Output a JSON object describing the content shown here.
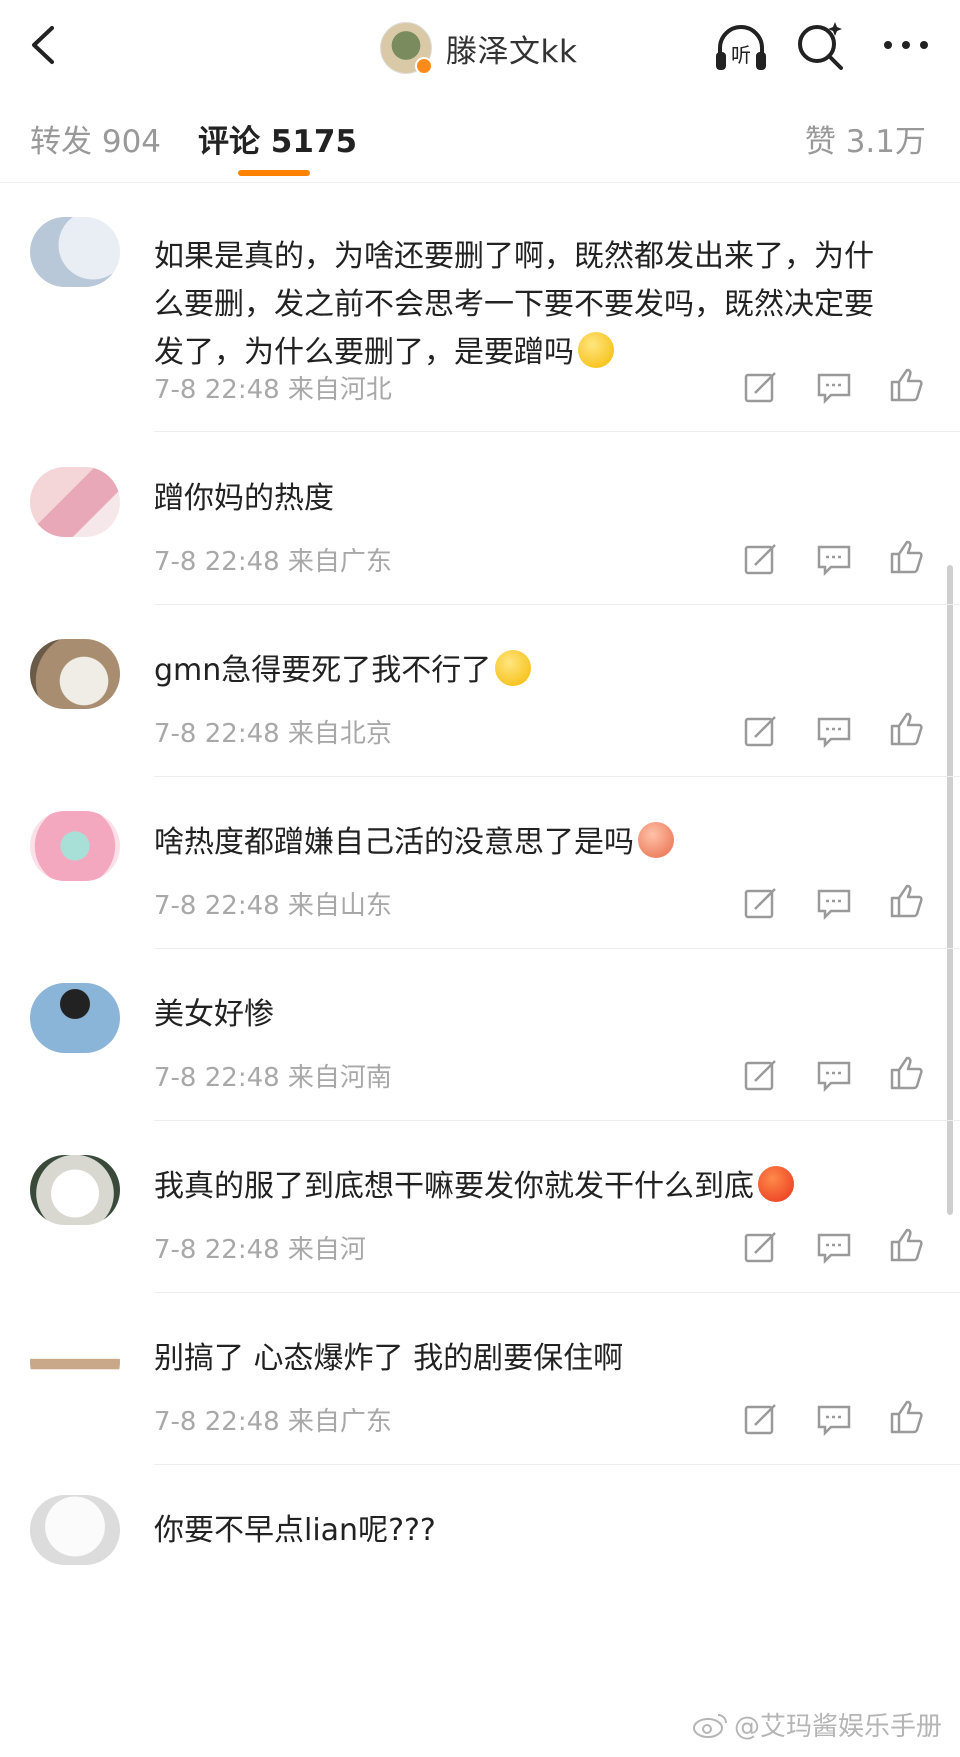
{
  "header": {
    "profile_name": "滕泽文kk",
    "listen_label": "听"
  },
  "tabs": {
    "repost": "转发 904",
    "comments": "评论 5175",
    "likes": "赞 3.1万"
  },
  "comments": [
    {
      "text": "如果是真的，为啥还要删了啊，既然都发出来了，为什么要删，发之前不会思考一下要不要发吗，既然决定要发了，为什么要删了，是要蹭吗",
      "emoji": "yellow",
      "meta": "7-8 22:48 来自河北"
    },
    {
      "text": "蹭你妈的热度",
      "emoji": "",
      "meta": "7-8 22:48 来自广东"
    },
    {
      "text": "gmn急得要死了我不行了",
      "emoji": "yellow",
      "meta": "7-8 22:48 来自北京"
    },
    {
      "text": "啥热度都蹭嫌自己活的没意思了是吗",
      "emoji": "pink",
      "meta": "7-8 22:48 来自山东"
    },
    {
      "text": "美女好惨",
      "emoji": "",
      "meta": "7-8 22:48 来自河南"
    },
    {
      "text": "我真的服了到底想干嘛要发你就发干什么到底",
      "emoji": "red",
      "meta": "7-8 22:48 来自河"
    },
    {
      "text": "别搞了 心态爆炸了 我的剧要保住啊",
      "emoji": "",
      "meta": "7-8 22:48 来自广东"
    },
    {
      "text": "你要不早点lian呢???",
      "emoji": "",
      "meta": ""
    }
  ],
  "watermark": "@艾玛酱娱乐手册",
  "colors": {
    "accent": "#ff8200",
    "meta_text": "#a8a8a8",
    "inactive_tab": "#999999"
  }
}
